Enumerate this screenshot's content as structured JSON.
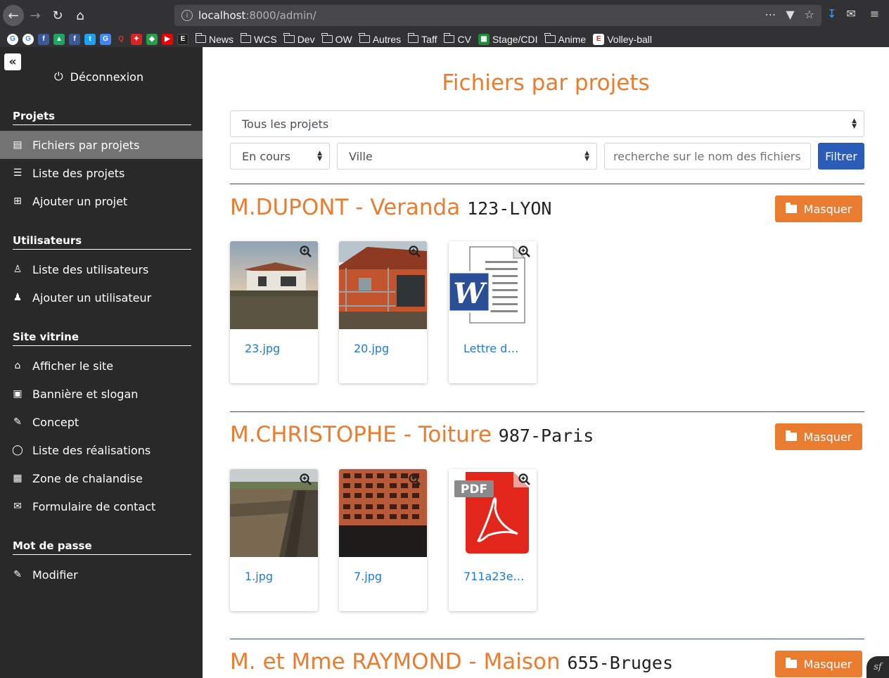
{
  "browser": {
    "url_host": "localhost",
    "url_path": ":8000/admin/",
    "bookmarks": [
      "News",
      "WCS",
      "Dev",
      "OW",
      "Autres",
      "Taff",
      "CV",
      "Stage/CDI",
      "Anime",
      "Volley-ball"
    ]
  },
  "sidebar": {
    "logout_label": "Déconnexion",
    "sections": [
      {
        "title": "Projets",
        "items": [
          "Fichiers par projets",
          "Liste des projets",
          "Ajouter un projet"
        ]
      },
      {
        "title": "Utilisateurs",
        "items": [
          "Liste des utilisateurs",
          "Ajouter un utilisateur"
        ]
      },
      {
        "title": "Site vitrine",
        "items": [
          "Afficher le site",
          "Bannière et slogan",
          "Concept",
          "Liste des réalisations",
          "Zone de chalandise",
          "Formulaire de contact"
        ]
      },
      {
        "title": "Mot de passe",
        "items": [
          "Modifier"
        ]
      }
    ]
  },
  "main": {
    "title": "Fichiers par projets",
    "project_select": "Tous les projets",
    "status_select": "En cours",
    "city_select": "Ville",
    "search_placeholder": "recherche sur le nom des fichiers",
    "filter_label": "Filtrer",
    "hide_label": "Masquer",
    "projects": [
      {
        "name": "M.DUPONT - Veranda",
        "code": "123-LYON",
        "files": [
          "23.jpg",
          "20.jpg",
          "Lettre d…"
        ]
      },
      {
        "name": "M.CHRISTOPHE - Toiture",
        "code": "987-Paris",
        "files": [
          "1.jpg",
          "7.jpg",
          "711a23e…"
        ]
      },
      {
        "name": "M. et Mme RAYMOND - Maison",
        "code": "655-Bruges",
        "files": []
      }
    ]
  },
  "colors": {
    "accent": "#ea7c2f",
    "primary": "#2a5cb8",
    "sidebar_bg": "#292929",
    "link": "#1f7ad8"
  }
}
